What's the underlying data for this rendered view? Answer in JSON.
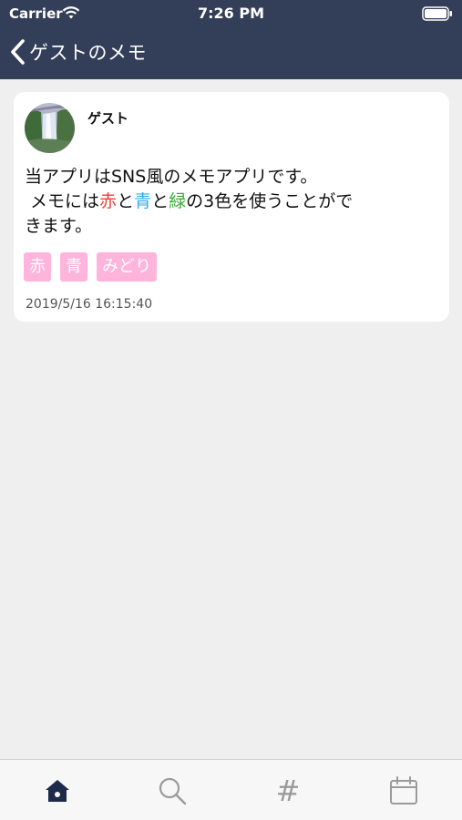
{
  "status_bar": {
    "carrier": "Carrier",
    "time": "7:26 PM",
    "icons": [
      "wifi-icon",
      "battery-icon"
    ]
  },
  "nav": {
    "title": "ゲストのメモ",
    "back_icon": "chevron-left-icon"
  },
  "memo": {
    "author": "ゲスト",
    "text": {
      "line1": "当アプリはSNS風のメモアプリです。",
      "line2_before": " メモには",
      "word_red": "赤",
      "conj1": "と",
      "word_blue": "青",
      "conj2": "と",
      "word_green": "緑",
      "line2_after": "の3色を使うことがで",
      "line3": "きます。"
    },
    "tags": [
      "赤",
      "青",
      "みどり"
    ],
    "timestamp": "2019/5/16 16:15:40"
  },
  "tab_bar": {
    "tabs": [
      {
        "icon": "home-icon",
        "active": true
      },
      {
        "icon": "search-icon",
        "active": false
      },
      {
        "icon": "hashtag-icon",
        "label": "#",
        "active": false
      },
      {
        "icon": "calendar-icon",
        "active": false
      }
    ]
  },
  "colors": {
    "header_bg": "#333e58",
    "background": "#efefef",
    "tag_bg": "#ffb4dc",
    "text_red": "#e8413a",
    "text_blue": "#35a9e8",
    "text_green": "#3aa83a",
    "tab_active": "#1e2a4a",
    "tab_inactive": "#9b9b9b"
  }
}
